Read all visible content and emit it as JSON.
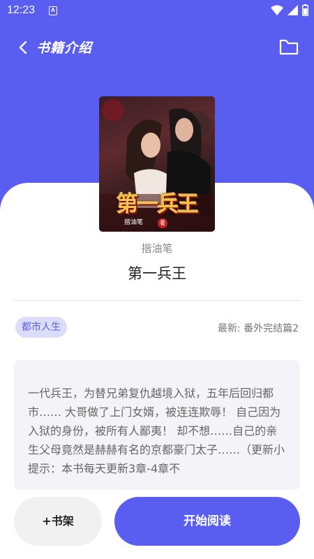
{
  "status_bar": {
    "time": "12:23",
    "notification_glyph": "A",
    "icons": [
      "wifi-icon",
      "signal-icon",
      "battery-icon"
    ]
  },
  "app_bar": {
    "title": "书籍介绍",
    "left_icon": "back-icon",
    "right_icon": "folder-icon"
  },
  "book": {
    "cover_title": "第一兵王",
    "cover_author": "揩油笔",
    "cover_badge": "著",
    "author": "揩油笔",
    "title": "第一兵王",
    "genre": "都市人生",
    "latest_chapter": "最新: 番外完结篇2",
    "summary": "一代兵王，为替兄弟复仇越境入狱，五年后回归都市…… 大哥做了上门女婿，被连连欺辱！ 自己因为入狱的身份，被所有人鄙夷！ 却不想……自己的亲生父母竟然是赫赫有名的京都豪门太子……（更新小提示：本书每天更新3章-4章不"
  },
  "actions": {
    "add_to_shelf": "+书架",
    "start_reading": "开始阅读"
  },
  "colors": {
    "accent": "#5a5ef0",
    "tag_background": "#dcdcfb",
    "summary_background": "#f4f4f8"
  }
}
